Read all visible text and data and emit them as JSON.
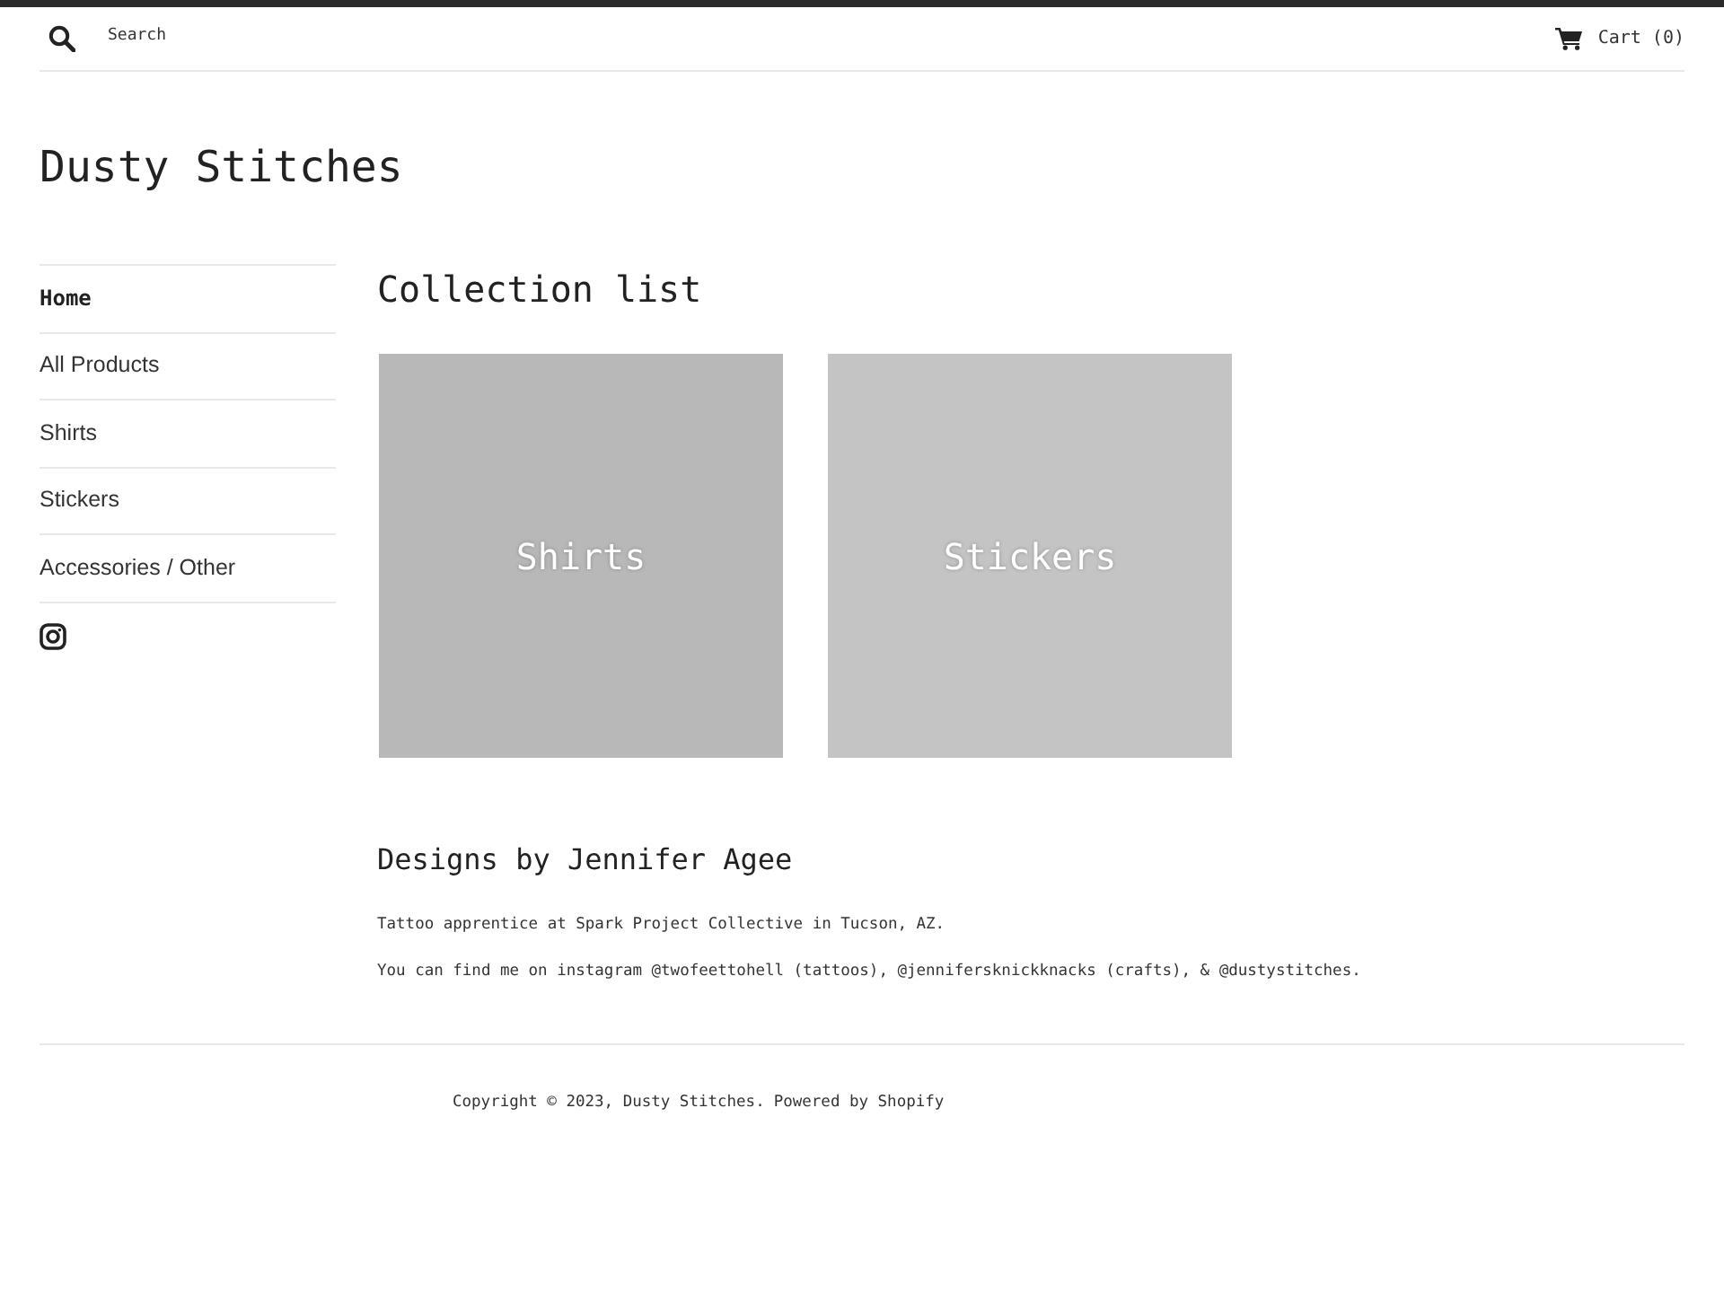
{
  "header": {
    "search": {
      "placeholder": "Search"
    },
    "cart": "Cart (0)"
  },
  "site_title": "Dusty Stitches",
  "sidebar": {
    "items": [
      {
        "label": "Home",
        "selected": true
      },
      {
        "label": "All Products",
        "selected": false
      },
      {
        "label": "Shirts",
        "selected": false
      },
      {
        "label": "Stickers",
        "selected": false
      },
      {
        "label": "Accessories / Other",
        "selected": false
      }
    ]
  },
  "main": {
    "heading": "Collection list",
    "collections": [
      {
        "title": "Shirts",
        "color": "#b8b8b8"
      },
      {
        "title": "Stickers",
        "color": "#c4c4c4"
      }
    ],
    "about": {
      "heading": "Designs by Jennifer Agee",
      "paragraphs": [
        "Tattoo apprentice at Spark Project Collective in Tucson, AZ.",
        "You can find me on instagram @twofeettohell (tattoos), @jennifersknickknacks (crafts), & @dustystitches."
      ]
    }
  },
  "footer": {
    "copyright": "Copyright © 2023, Dusty Stitches.",
    "powered_by": "Powered by Shopify"
  }
}
